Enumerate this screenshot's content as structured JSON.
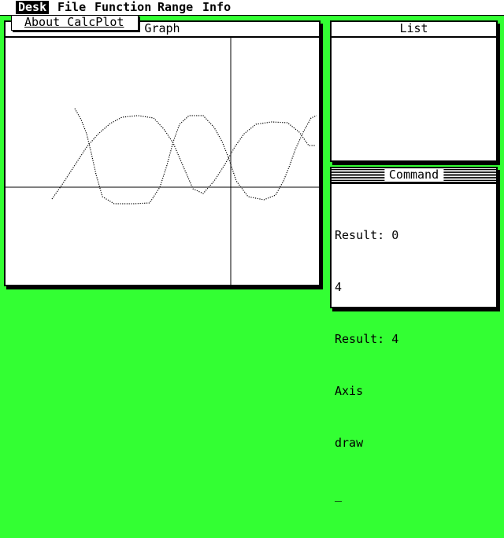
{
  "menubar": {
    "items": [
      "Desk",
      "File",
      "Function",
      "Range",
      "Info"
    ],
    "selected": "Desk"
  },
  "dropdown": {
    "items": [
      "About CalcPlot"
    ]
  },
  "graph_window": {
    "title": "Graph",
    "curves": {
      "curve1": [
        [
          66,
          253
        ],
        [
          80,
          233
        ],
        [
          95,
          210
        ],
        [
          110,
          187
        ],
        [
          125,
          170
        ],
        [
          140,
          157
        ],
        [
          155,
          149
        ],
        [
          175,
          147
        ],
        [
          195,
          150
        ],
        [
          208,
          164
        ],
        [
          220,
          182
        ],
        [
          232,
          210
        ],
        [
          245,
          240
        ],
        [
          258,
          246
        ],
        [
          272,
          230
        ],
        [
          285,
          210
        ],
        [
          298,
          187
        ],
        [
          310,
          170
        ],
        [
          325,
          158
        ],
        [
          345,
          155
        ],
        [
          365,
          156
        ],
        [
          380,
          168
        ],
        [
          392,
          185
        ],
        [
          400,
          185
        ]
      ],
      "curve2": [
        [
          95,
          138
        ],
        [
          103,
          152
        ],
        [
          110,
          170
        ],
        [
          116,
          195
        ],
        [
          122,
          222
        ],
        [
          130,
          250
        ],
        [
          145,
          259
        ],
        [
          170,
          259
        ],
        [
          190,
          258
        ],
        [
          203,
          238
        ],
        [
          212,
          210
        ],
        [
          220,
          180
        ],
        [
          228,
          158
        ],
        [
          240,
          147
        ],
        [
          258,
          147
        ],
        [
          272,
          162
        ],
        [
          282,
          180
        ],
        [
          290,
          200
        ],
        [
          300,
          230
        ],
        [
          315,
          250
        ],
        [
          335,
          254
        ],
        [
          350,
          248
        ],
        [
          360,
          230
        ],
        [
          368,
          210
        ],
        [
          375,
          190
        ],
        [
          385,
          168
        ],
        [
          395,
          150
        ],
        [
          402,
          147
        ]
      ]
    }
  },
  "list_window": {
    "title": "List"
  },
  "command_window": {
    "title": "Command",
    "lines": [
      "Result: 0",
      "4",
      "Result: 4",
      "Axis",
      "draw"
    ],
    "cursor": "_"
  }
}
